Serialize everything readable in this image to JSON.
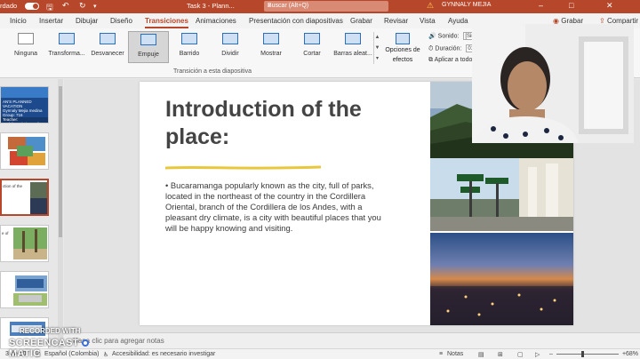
{
  "titlebar": {
    "saved_label": "rdado",
    "document_title": "Task 3 - Plann...",
    "search_placeholder": "Buscar (Alt+Q)",
    "user_name": "GYNNALY MEJIA"
  },
  "menu": {
    "tabs": [
      "Inicio",
      "Insertar",
      "Dibujar",
      "Diseño",
      "Transiciones",
      "Animaciones",
      "Presentación con diapositivas",
      "Grabar",
      "Revisar",
      "Vista",
      "Ayuda"
    ],
    "active_tab": "Transiciones",
    "right_buttons": [
      "Grabar",
      "Compartir"
    ]
  },
  "ribbon": {
    "transitions": [
      "Ninguna",
      "Transforma...",
      "Desvanecer",
      "Empuje",
      "Barrido",
      "Dividir",
      "Mostrar",
      "Cortar",
      "Barras aleat..."
    ],
    "selected_transition": "Empuje",
    "effect_options_line1": "Opciones de",
    "effect_options_line2": "efectos",
    "group_label": "Transición a esta diapositiva",
    "sound_label": "Sonido:",
    "sound_value": "[Sin",
    "duration_label": "Duración:",
    "duration_value": "01,00",
    "apply_all_label": "Aplicar a todo"
  },
  "thumbnails": [
    {
      "number": "1",
      "text": "AN'S PLANNED VACATION\nGynnaly Mejia medina\nGroup: 716\nTeacher:\nAndrés Quintin medina"
    },
    {
      "number": "2",
      "text": ""
    },
    {
      "number": "3",
      "text": "ction of the"
    },
    {
      "number": "4",
      "text": "e of"
    },
    {
      "number": "5",
      "text": ""
    },
    {
      "number": "6",
      "text": ""
    }
  ],
  "selected_thumbnail": 3,
  "slide": {
    "title": "Introduction of the place:",
    "body": "• Bucaramanga popularly known as the city, full of parks, located in the northeast of the country in the Cordillera Oriental, branch of the Cordillera de los Andes, with a pleasant dry climate, is a city with beautiful places that you will be happy knowing and visiting."
  },
  "notes_placeholder": "Haga clic para agregar notas",
  "status": {
    "slide_counter": "3 de 10",
    "language": "Español (Colombia)",
    "accessibility": "Accesibilidad: es necesario investigar",
    "notes_label": "Notas",
    "zoom": "68%"
  },
  "watermark": {
    "line1": "RECORDED WITH",
    "line2": "SCREENCAST",
    "line3": "MATIC"
  },
  "colors": {
    "accent": "#b7472a",
    "underline": "#e8c83a",
    "selected_border": "#b7472a"
  }
}
